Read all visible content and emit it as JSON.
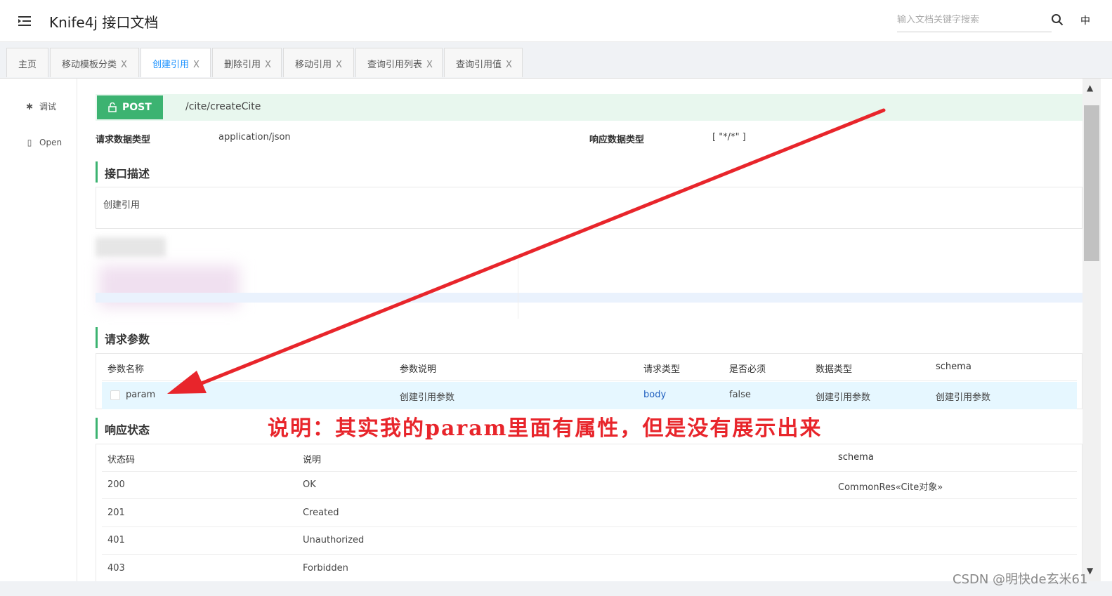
{
  "header": {
    "title": "Knife4j 接口文档",
    "search_placeholder": "输入文档关键字搜索",
    "lang": "中"
  },
  "tabs": [
    {
      "label": "主页",
      "closable": false
    },
    {
      "label": "移动模板分类",
      "closable": true
    },
    {
      "label": "创建引用",
      "closable": true,
      "active": true
    },
    {
      "label": "删除引用",
      "closable": true
    },
    {
      "label": "移动引用",
      "closable": true
    },
    {
      "label": "查询引用列表",
      "closable": true
    },
    {
      "label": "查询引用值",
      "closable": true
    }
  ],
  "tab_close": "X",
  "leftnav": {
    "items": [
      {
        "label": "调试",
        "icon": "bug-icon"
      },
      {
        "label": "Open",
        "icon": "document-icon"
      }
    ]
  },
  "api": {
    "method": "POST",
    "path": "/cite/createCite",
    "req_type_label": "请求数据类型",
    "req_type_value": "application/json",
    "resp_type_label": "响应数据类型",
    "resp_type_value": "[ \"*/*\" ]",
    "desc_section": "接口描述",
    "desc_text": "创建引用"
  },
  "params": {
    "section": "请求参数",
    "headers": [
      "参数名称",
      "参数说明",
      "请求类型",
      "是否必须",
      "数据类型",
      "schema"
    ],
    "rows": [
      {
        "name": "param",
        "desc": "创建引用参数",
        "in": "body",
        "required": "false",
        "type": "创建引用参数",
        "schema": "创建引用参数"
      }
    ]
  },
  "responses": {
    "section": "响应状态",
    "headers": [
      "状态码",
      "说明",
      "schema"
    ],
    "rows": [
      {
        "code": "200",
        "desc": "OK",
        "schema": "CommonRes«Cite对象»"
      },
      {
        "code": "201",
        "desc": "Created",
        "schema": ""
      },
      {
        "code": "401",
        "desc": "Unauthorized",
        "schema": ""
      },
      {
        "code": "403",
        "desc": "Forbidden",
        "schema": ""
      }
    ]
  },
  "annotation": {
    "text": "说明：其实我的param里面有属性，但是没有展示出来",
    "color": "#e8252b"
  },
  "watermark": "CSDN @明快de玄米61",
  "colors": {
    "accent": "#3cb371",
    "active_tab": "#1890ff",
    "highlight_row": "#e6f7ff"
  }
}
